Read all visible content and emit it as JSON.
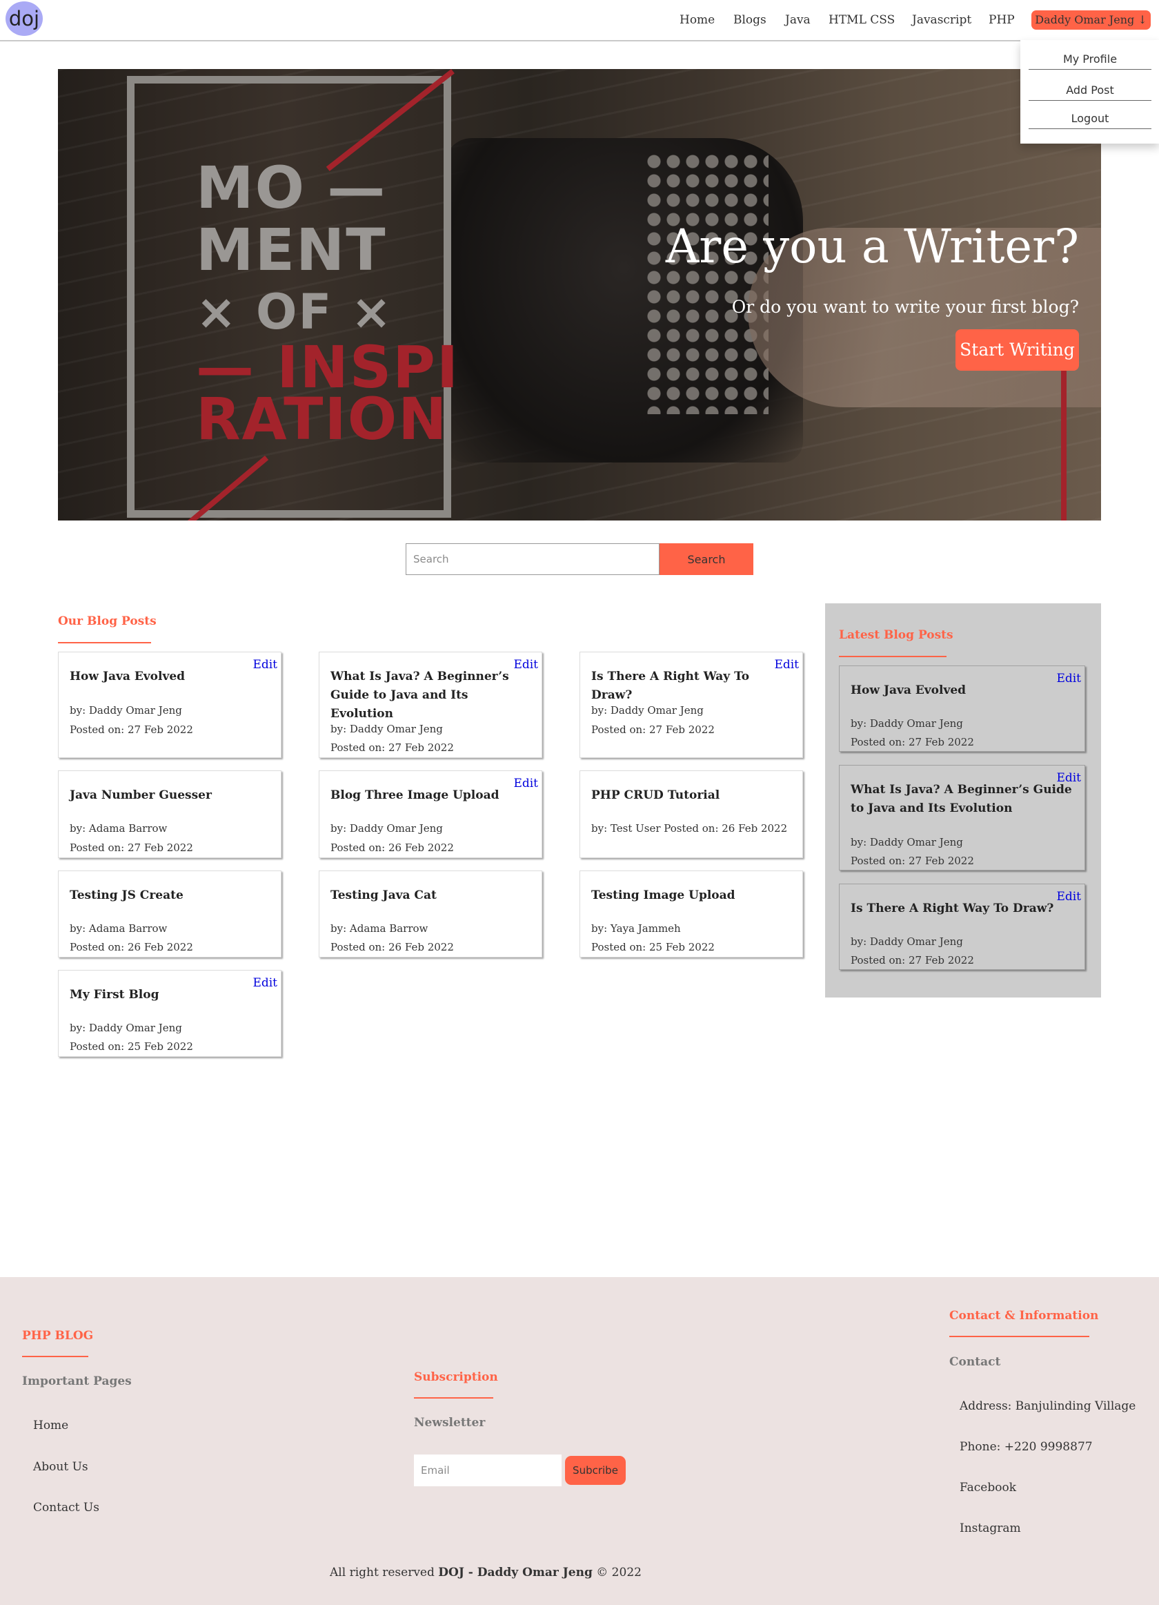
{
  "nav": {
    "logo": "doj",
    "links": [
      "Home",
      "Blogs",
      "Java",
      "HTML CSS",
      "Javascript",
      "PHP"
    ],
    "user_button": "Daddy Omar Jeng ↓",
    "dropdown": [
      "My Profile",
      "Add Post",
      "Logout"
    ]
  },
  "hero": {
    "image_text": [
      "MO —",
      "MENT",
      "× OF ×",
      "— INSPI",
      "RATION"
    ],
    "title": "Are you a Writer?",
    "subtitle": "Or do you want to write your first blog?",
    "cta": "Start Writing"
  },
  "search": {
    "placeholder": "Search",
    "button": "Search"
  },
  "blog": {
    "heading": "Our Blog Posts",
    "edit_label": "Edit",
    "posts": [
      {
        "title": "How Java Evolved",
        "author": "by: Daddy Omar Jeng",
        "date": "Posted on: 27 Feb 2022",
        "editable": true
      },
      {
        "title": "What Is Java? A Beginner’s Guide to Java and Its Evolution",
        "author": "by: Daddy Omar Jeng",
        "date": "Posted on: 27 Feb 2022",
        "editable": true
      },
      {
        "title": "Is There A Right Way To Draw?",
        "author": "by: Daddy Omar Jeng",
        "date": "Posted on: 27 Feb 2022",
        "editable": true
      },
      {
        "title": "Java Number Guesser",
        "author": "by: Adama Barrow",
        "date": "Posted on: 27 Feb 2022",
        "editable": false
      },
      {
        "title": "Blog Three Image Upload",
        "author": "by: Daddy Omar Jeng",
        "date": "Posted on: 26 Feb 2022",
        "editable": true
      },
      {
        "title": "PHP CRUD Tutorial",
        "author": "by: Test User Posted on: 26 Feb 2022",
        "date": "",
        "editable": false
      },
      {
        "title": "Testing JS Create",
        "author": "by: Adama Barrow",
        "date": "Posted on: 26 Feb 2022",
        "editable": false
      },
      {
        "title": "Testing Java Cat",
        "author": "by: Adama Barrow",
        "date": "Posted on: 26 Feb 2022",
        "editable": false
      },
      {
        "title": "Testing Image Upload",
        "author": "by: Yaya Jammeh",
        "date": "Posted on: 25 Feb 2022",
        "editable": false
      },
      {
        "title": "My First Blog",
        "author": "by: Daddy Omar Jeng",
        "date": "Posted on: 25 Feb 2022",
        "editable": true
      }
    ]
  },
  "latest": {
    "heading": "Latest Blog Posts",
    "posts": [
      {
        "title": "How Java Evolved",
        "author": "by: Daddy Omar Jeng",
        "date": "Posted on: 27 Feb 2022"
      },
      {
        "title": "What Is Java? A Beginner’s Guide to Java and Its Evolution",
        "author": "by: Daddy Omar Jeng",
        "date": "Posted on: 27 Feb 2022"
      },
      {
        "title": "Is There A Right Way To Draw?",
        "author": "by: Daddy Omar Jeng",
        "date": "Posted on: 27 Feb 2022"
      }
    ]
  },
  "footer": {
    "brand": "PHP BLOG",
    "pages_heading": "Important Pages",
    "pages": [
      "Home",
      "About Us",
      "Contact Us"
    ],
    "subscription_heading": "Subscription",
    "newsletter_heading": "Newsletter",
    "email_placeholder": "Email",
    "subscribe_button": "Subcribe",
    "contact_heading": "Contact & Information",
    "contact_sub": "Contact",
    "contact_items": [
      "Address: Banjulinding Village",
      "Phone: +220 9998877",
      "Facebook",
      "Instagram"
    ],
    "copyright_prefix": "All right reserved ",
    "copyright_owner": "DOJ - Daddy Omar Jeng",
    "copyright_suffix": " © 2022"
  },
  "colors": {
    "accent": "#ff6347",
    "edit_link": "#0000dd",
    "sidebar_bg": "#cccccc",
    "footer_bg": "#ece2e1"
  }
}
